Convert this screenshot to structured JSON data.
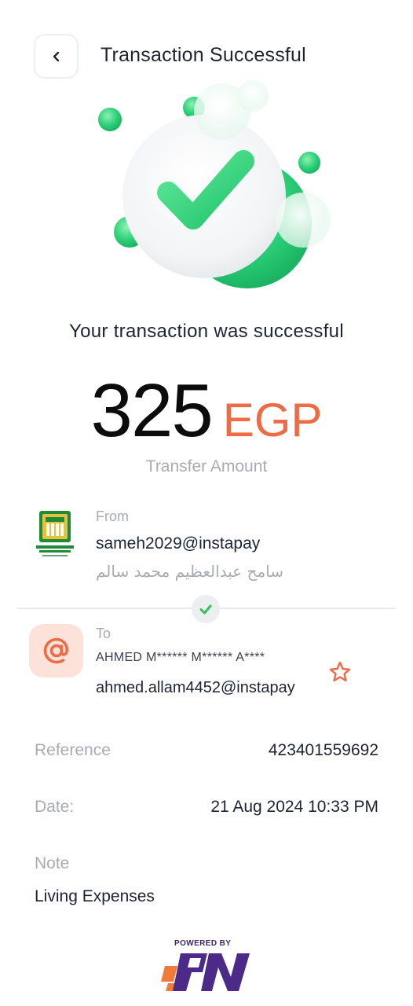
{
  "header": {
    "title": "Transaction Successful"
  },
  "status": {
    "message": "Your transaction was successful"
  },
  "amount": {
    "value": "325",
    "currency": "EGP",
    "label": "Transfer Amount"
  },
  "from": {
    "label": "From",
    "address": "sameh2029@instapay",
    "name": "سامح عبدالعظيم محمد سالم",
    "bank_logo": "bank-logo"
  },
  "to": {
    "label": "To",
    "masked_name": "AHMED M****** M****** A****",
    "address": "ahmed.allam4452@instapay",
    "avatar_icon": "at-icon"
  },
  "details": {
    "reference_label": "Reference",
    "reference_value": "423401559692",
    "date_label": "Date:",
    "date_value": "21 Aug 2024 10:33 PM",
    "note_label": "Note",
    "note_value": "Living Expenses"
  },
  "footer": {
    "powered_by": "POWERED BY"
  },
  "colors": {
    "accent": "#ef6b45",
    "success": "#2fd27a",
    "text": "#1c2434",
    "muted": "#a7acb4"
  }
}
